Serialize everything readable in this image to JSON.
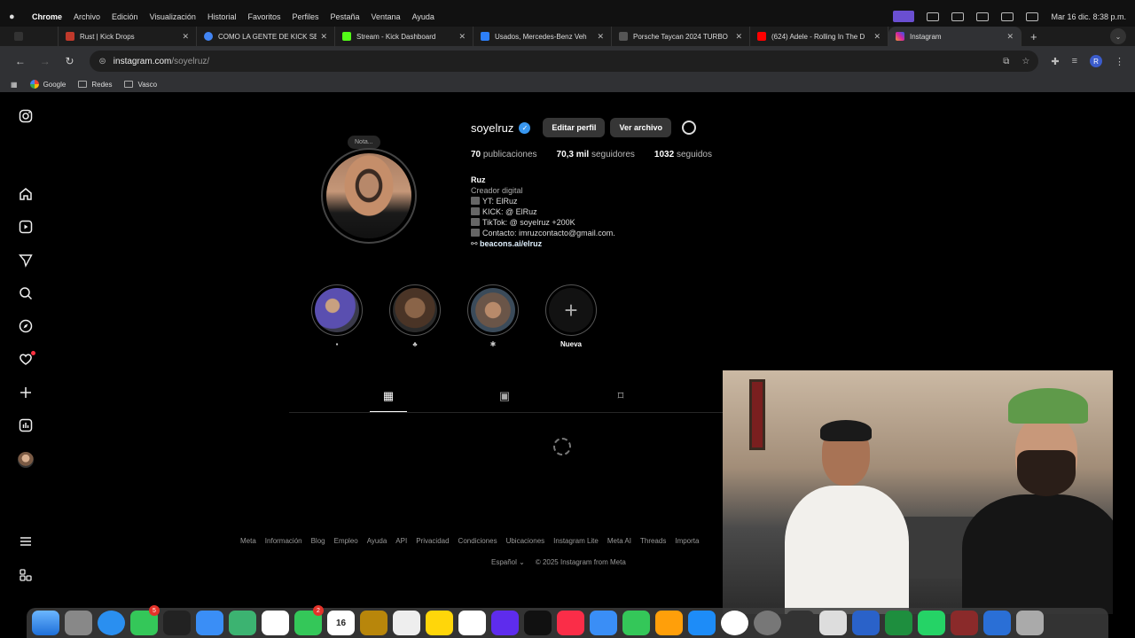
{
  "menubar": {
    "app": "Chrome",
    "items": [
      "Archivo",
      "Edición",
      "Visualización",
      "Historial",
      "Favoritos",
      "Perfiles",
      "Pestaña",
      "Ventana",
      "Ayuda"
    ],
    "datetime": "Mar 16 dic.  8:38 p.m."
  },
  "tabs": [
    {
      "title": "Rust | Kick Drops",
      "color": "#c0392b"
    },
    {
      "title": "COMO LA GENTE DE KICK SE",
      "color": "#4285f4"
    },
    {
      "title": "Stream - Kick Dashboard",
      "color": "#53fc18"
    },
    {
      "title": "Usados, Mercedes-Benz Veh",
      "color": "#2d7ff9"
    },
    {
      "title": "Porsche Taycan 2024 TURBO",
      "color": "#555555"
    },
    {
      "title": "(624) Adele - Rolling In The D",
      "color": "#ff0000"
    },
    {
      "title": "Instagram",
      "color": "#d6249f"
    }
  ],
  "address": {
    "domain": "instagram.com",
    "path": "/soyelruz/"
  },
  "profile_initial": "R",
  "bookmarks": [
    "Google",
    "Redes",
    "Vasco"
  ],
  "profile": {
    "note": "Nota...",
    "username": "soyelruz",
    "verified_mark": "✓",
    "edit_label": "Editar perfil",
    "archive_label": "Ver archivo",
    "posts_count": "70",
    "posts_label": "publicaciones",
    "followers_count": "70,3 mil",
    "followers_label": "seguidores",
    "following_count": "1032",
    "following_label": "seguidos",
    "bio_name": "Ruz",
    "bio_category": "Creador digital",
    "bio_lines": [
      "YT: ElRuz",
      "KICK: @ ElRuz",
      "TikTok: @ soyelruz +200K",
      "Contacto: imruzcontacto@gmail.com."
    ],
    "link": "beacons.ai/elruz"
  },
  "highlights": [
    {
      "caption": "▪",
      "color": "#5a4fb0"
    },
    {
      "caption": "♣",
      "color": "#6b4a36"
    },
    {
      "caption": "✱",
      "color": "#8a6a55"
    },
    {
      "caption": "Nueva",
      "new_symbol": "+"
    }
  ],
  "footer": {
    "links": [
      "Meta",
      "Información",
      "Blog",
      "Empleo",
      "Ayuda",
      "API",
      "Privacidad",
      "Condiciones",
      "Ubicaciones",
      "Instagram Lite",
      "Meta AI",
      "Threads",
      "Importa"
    ],
    "language": "Español ⌄",
    "copyright": "© 2025 Instagram from Meta"
  },
  "dock_badges": {
    "messages": "5",
    "facetime": "2",
    "calendar_day": "16"
  },
  "icons": [
    "instagram-icon",
    "home-icon",
    "reels-icon",
    "send-icon",
    "search-icon",
    "explore-icon",
    "heart-icon",
    "create-icon",
    "dashboard-icon",
    "grid-icon",
    "reels-tab-icon",
    "saved-icon",
    "menu-icon",
    "threads-icon"
  ]
}
